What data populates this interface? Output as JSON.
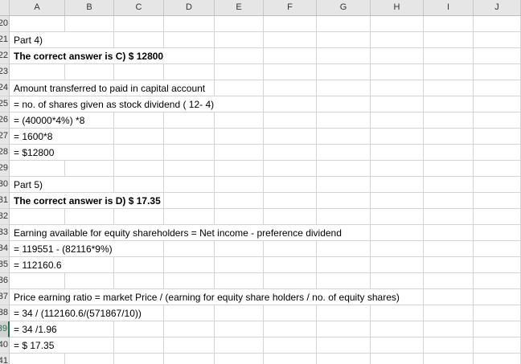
{
  "columns": [
    "A",
    "B",
    "C",
    "D",
    "E",
    "F",
    "G",
    "H",
    "I",
    "J"
  ],
  "active_row": "39",
  "rows": [
    {
      "num": "20",
      "text": "",
      "bold": false
    },
    {
      "num": "21",
      "text": "Part 4)",
      "bold": false
    },
    {
      "num": "22",
      "text": "The correct answer is C) $ 12800",
      "bold": true
    },
    {
      "num": "23",
      "text": "",
      "bold": false
    },
    {
      "num": "24",
      "text": "Amount transferred to paid in capital account",
      "bold": false
    },
    {
      "num": "25",
      "text": "= no. of shares given as stock dividend ( 12- 4)",
      "bold": false
    },
    {
      "num": "26",
      "text": "= (40000*4%) *8",
      "bold": false
    },
    {
      "num": "27",
      "text": "= 1600*8",
      "bold": false
    },
    {
      "num": "28",
      "text": "= $12800",
      "bold": false
    },
    {
      "num": "29",
      "text": "",
      "bold": false
    },
    {
      "num": "30",
      "text": "Part 5)",
      "bold": false
    },
    {
      "num": "31",
      "text": "The correct answer is D) $ 17.35",
      "bold": true
    },
    {
      "num": "32",
      "text": "",
      "bold": false
    },
    {
      "num": "33",
      "text": "Earning available for equity shareholders = Net income - preference dividend",
      "bold": false
    },
    {
      "num": "34",
      "text": "= 119551 - (82116*9%)",
      "bold": false
    },
    {
      "num": "35",
      "text": "= 112160.6",
      "bold": false
    },
    {
      "num": "36",
      "text": "",
      "bold": false
    },
    {
      "num": "37",
      "text": "Price earning ratio = market Price / (earning for equity share holders / no. of equity shares)",
      "bold": false
    },
    {
      "num": "38",
      "text": "= 34 / (112160.6/(571867/10))",
      "bold": false
    },
    {
      "num": "39",
      "text": "= 34 /1.96",
      "bold": false
    },
    {
      "num": "40",
      "text": "= $ 17.35",
      "bold": false
    },
    {
      "num": "41",
      "text": "",
      "bold": false
    }
  ]
}
